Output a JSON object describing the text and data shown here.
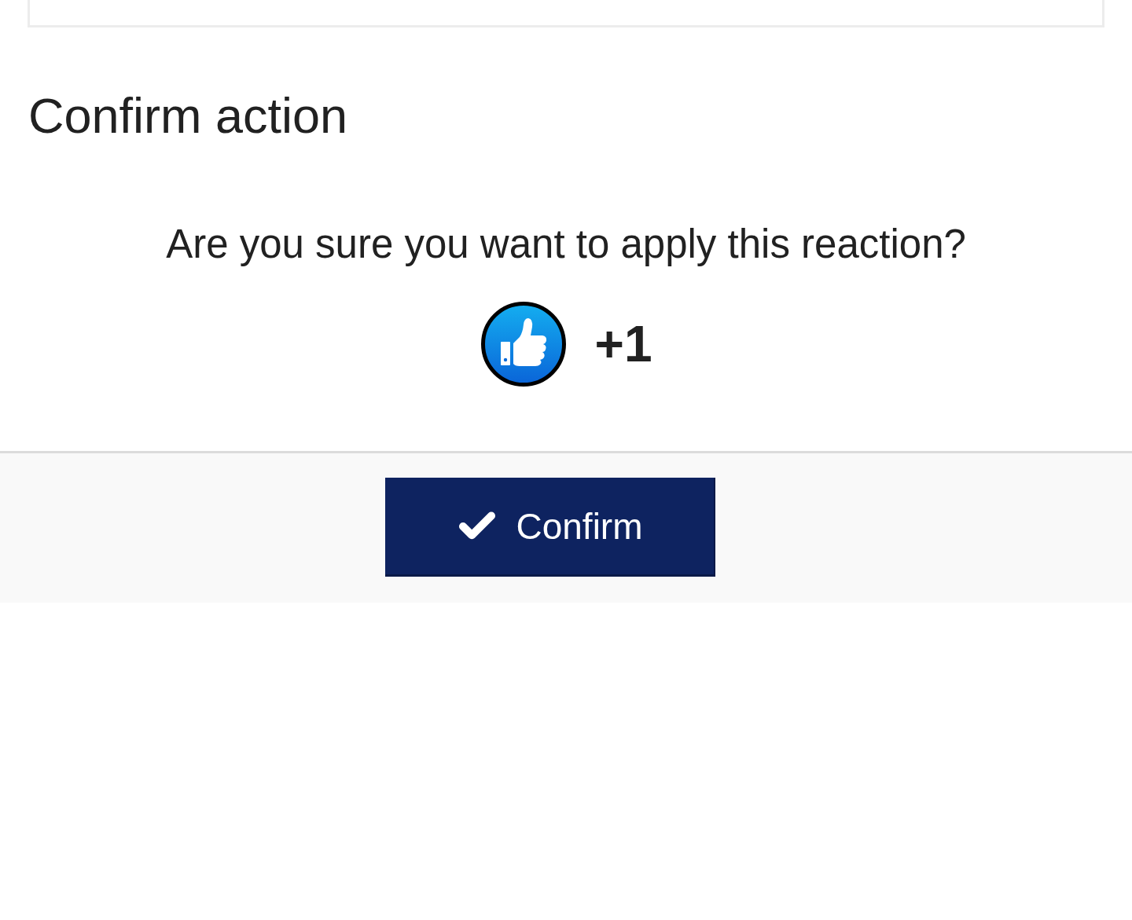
{
  "dialog": {
    "title": "Confirm action",
    "message": "Are you sure you want to apply this reaction?",
    "reaction": {
      "label": "+1"
    },
    "confirm_button": {
      "label": "Confirm"
    }
  }
}
